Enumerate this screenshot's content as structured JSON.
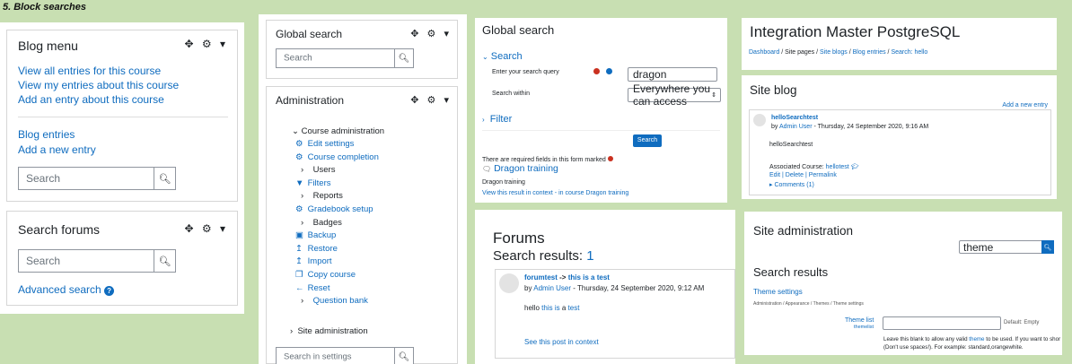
{
  "heading": "5. Block searches",
  "blog_menu": {
    "title": "Blog menu",
    "controls": "✥ ⚙ ▾",
    "links": [
      "View all entries for this course",
      "View my entries about this course",
      "Add an entry about this course"
    ],
    "links2": [
      "Blog entries",
      "Add a new entry"
    ],
    "search_placeholder": "Search"
  },
  "search_forums": {
    "title": "Search forums",
    "controls": "✥ ⚙ ▾",
    "search_placeholder": "Search",
    "advanced": "Advanced search"
  },
  "global_search_block": {
    "title": "Global search",
    "controls": "✥ ⚙ ▾",
    "search_placeholder": "Search"
  },
  "administration": {
    "title": "Administration",
    "controls": "✥ ⚙ ▾",
    "course_admin": "Course administration",
    "items": [
      {
        "icon": "⚙",
        "label": "Edit settings",
        "link": true
      },
      {
        "icon": "⚙",
        "label": "Course completion",
        "link": true
      },
      {
        "icon": "›",
        "label": "Users",
        "link": false
      },
      {
        "icon": "▼",
        "label": "Filters",
        "link": true
      },
      {
        "icon": "›",
        "label": "Reports",
        "link": false
      },
      {
        "icon": "⚙",
        "label": "Gradebook setup",
        "link": true
      },
      {
        "icon": "›",
        "label": "Badges",
        "link": false
      },
      {
        "icon": "▣",
        "label": "Backup",
        "link": true
      },
      {
        "icon": "↥",
        "label": "Restore",
        "link": true
      },
      {
        "icon": "↥",
        "label": "Import",
        "link": true
      },
      {
        "icon": "❐",
        "label": "Copy course",
        "link": true
      },
      {
        "icon": "←",
        "label": "Reset",
        "link": true
      },
      {
        "icon": "›",
        "label": "Question bank",
        "link": true
      }
    ],
    "site_admin": "Site administration",
    "search_placeholder": "Search in settings"
  },
  "global_search_page": {
    "title": "Global search",
    "search_section": "Search",
    "query_label": "Enter your search query",
    "query_value": "dragon",
    "within_label": "Search within",
    "within_value": "Everywhere you can access",
    "filter_section": "Filter",
    "search_button": "Search",
    "required_note": "There are required fields in this form marked",
    "result_title": "Dragon training",
    "result_text": "Dragon training",
    "result_links": "View this result in context - in course Dragon training"
  },
  "forums_page": {
    "title": "Forums",
    "results_label": "Search results:",
    "results_count": "1",
    "post_forum": "forumtest",
    "post_arrow": "->",
    "post_subject": "this is a test",
    "post_by": "by",
    "post_author": "Admin User",
    "post_date": "- Thursday, 24 September 2020, 9:12 AM",
    "body_hello": "hello",
    "body_this_is": "this is",
    "body_a": "a",
    "body_test": "test",
    "context_link": "See this post in context"
  },
  "site_blog_page": {
    "site_title": "Integration Master PostgreSQL",
    "breadcrumb": [
      "Dashboard",
      "Site pages",
      "Site blogs",
      "Blog entries",
      "Search: hello"
    ],
    "heading": "Site blog",
    "add_entry": "Add a new entry",
    "entry_title": "helloSearchtest",
    "entry_by": "by",
    "entry_author": "Admin User",
    "entry_date": "- Thursday, 24 September 2020, 9:16 AM",
    "entry_body": "helloSearchtest",
    "assoc_label": "Associated Course:",
    "assoc_course": "hellotest",
    "actions": "Edit | Delete | Permalink",
    "comments": "Comments (1)"
  },
  "site_admin_page": {
    "title": "Site administration",
    "search_value": "theme",
    "results_heading": "Search results",
    "section_link": "Theme settings",
    "path": "Administration / Appearance / Themes / Theme settings",
    "setting_label": "Theme list",
    "setting_key": "themelist",
    "default": "Default: Empty",
    "desc1_a": "Leave this blank to allow any valid",
    "desc1_b": "theme",
    "desc1_c": "to be used. If you want to shor",
    "desc2": "(Don't use spaces!). For example: standard,orangewhite."
  },
  "colors": {
    "background": "#c8dfb2",
    "link": "#0f6cbf",
    "required": "#ca3120"
  }
}
